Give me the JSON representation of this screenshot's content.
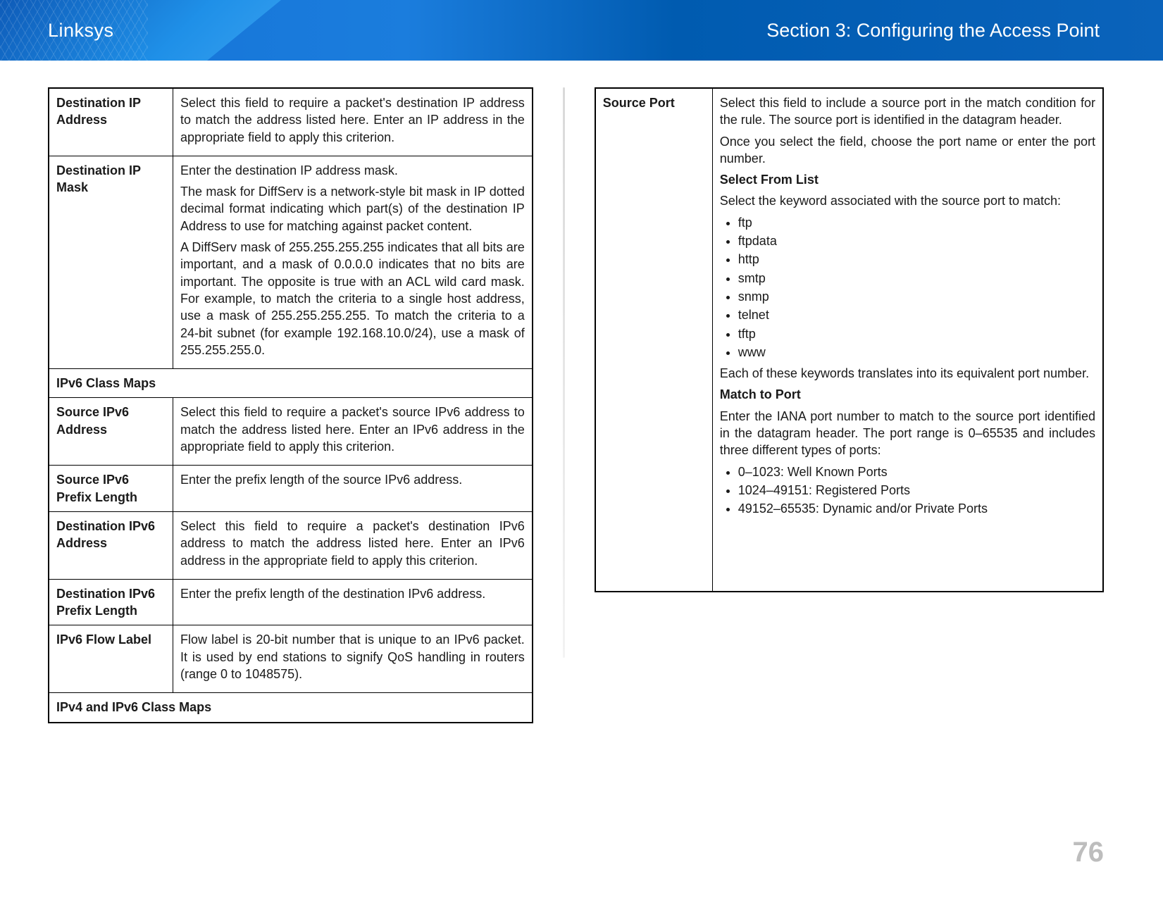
{
  "header": {
    "brand": "Linksys",
    "section": "Section 3:  Configuring the Access Point"
  },
  "page_number": "76",
  "left_table": {
    "rows": [
      {
        "label": "Destination IP Address",
        "paras": [
          "Select this field to require a packet's destination IP address to match the address listed here. Enter an IP address in the appropriate field to apply this criterion."
        ]
      },
      {
        "label": "Destination IP Mask",
        "paras": [
          "Enter the destination IP address mask.",
          "The mask for DiffServ is a network-style bit mask in IP dotted decimal format indicating which part(s) of the destination IP Address to use for matching against packet content.",
          "A DiffServ mask of 255.255.255.255 indicates that all bits are important, and a mask of 0.0.0.0 indicates that no bits are important. The opposite is true with an ACL wild card mask. For example, to match the criteria to a single host address, use a mask of 255.255.255.255. To match the criteria to a 24-bit subnet (for example 192.168.10.0/24), use a mask of 255.255.255.0."
        ]
      },
      {
        "section": "IPv6 Class Maps"
      },
      {
        "label": "Source IPv6 Address",
        "paras": [
          "Select this field to require a packet's source IPv6 address to match the address listed here. Enter an IPv6 address in the appropriate field to apply this criterion."
        ]
      },
      {
        "label": "Source IPv6 Prefix Length",
        "paras": [
          "Enter the prefix length of the source IPv6 address."
        ]
      },
      {
        "label": "Destination IPv6 Address",
        "paras": [
          "Select this field to require a packet's destination IPv6 address to match the address listed here. Enter an IPv6 address in the appropriate field to apply this criterion."
        ]
      },
      {
        "label": "Destination IPv6 Prefix Length",
        "paras": [
          "Enter the prefix length of the destination IPv6 address."
        ]
      },
      {
        "label": "IPv6 Flow Label",
        "paras": [
          "Flow label is 20-bit number that is unique to an IPv6 packet. It is used by end stations to signify QoS handling in routers (range 0 to 1048575)."
        ]
      },
      {
        "section": "IPv4 and IPv6 Class Maps"
      }
    ]
  },
  "right_table": {
    "label": "Source Port",
    "intro": [
      "Select this field to include a source port in the match condition for the rule. The source port is identified in the datagram header.",
      "Once you select the field, choose the port name or enter the port number."
    ],
    "select_from_list": {
      "title": "Select From List",
      "lead": "Select the keyword associated with the source port to match:",
      "items": [
        "ftp",
        "ftpdata",
        "http",
        "smtp",
        "snmp",
        "telnet",
        "tftp",
        "www"
      ],
      "tail": "Each of these keywords translates into its equivalent port number."
    },
    "match_to_port": {
      "title": "Match to Port",
      "lead": "Enter the IANA port number to match to the source port identified in the datagram header. The port range is 0–65535 and includes three different types of ports:",
      "items": [
        "0–1023: Well Known Ports",
        "1024–49151: Registered Ports",
        "49152–65535: Dynamic and/or Private Ports"
      ]
    }
  }
}
